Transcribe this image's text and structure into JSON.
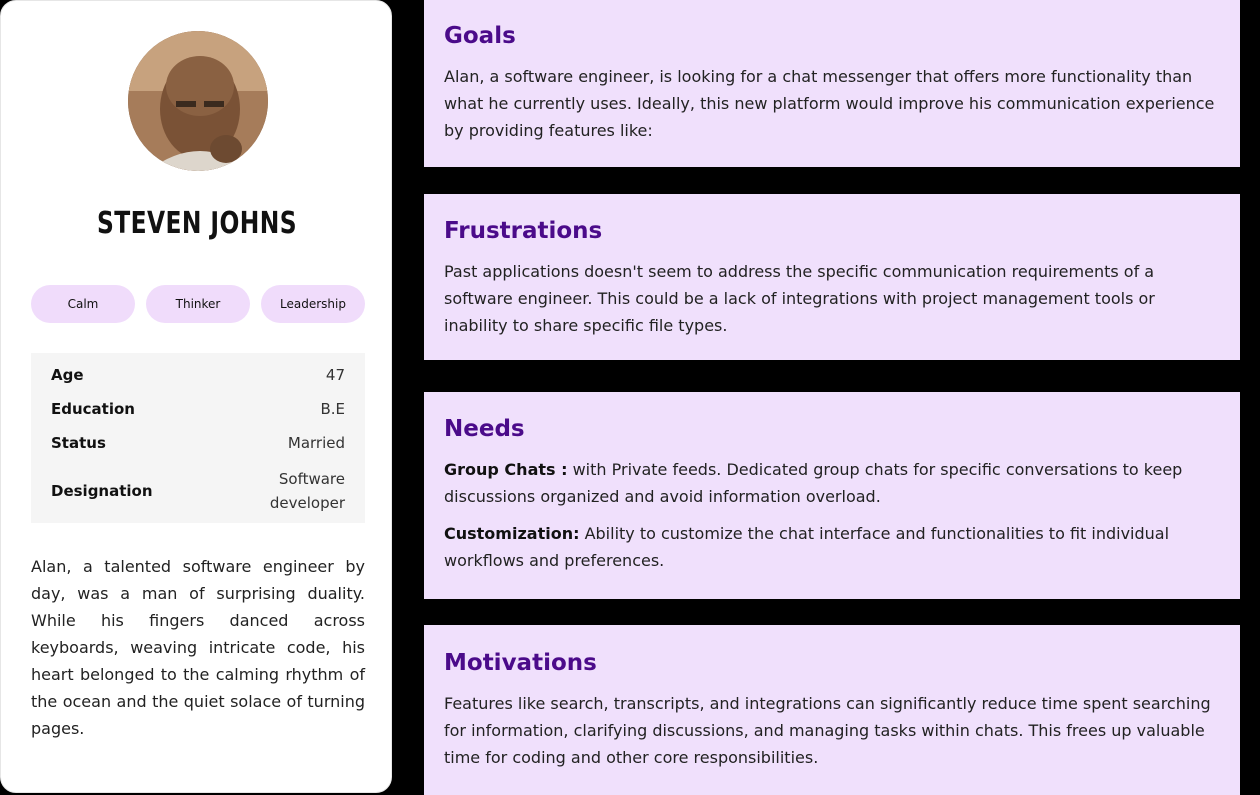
{
  "profile": {
    "name": "STEVEN JOHNS",
    "tags": [
      "Calm",
      "Thinker",
      "Leadership"
    ],
    "info": [
      {
        "key": "Age",
        "value": "47"
      },
      {
        "key": "Education",
        "value": "B.E"
      },
      {
        "key": "Status",
        "value": "Married"
      },
      {
        "key": "Designation",
        "value": "Software developer"
      }
    ],
    "bio": "Alan, a talented software engineer by day, was a man of surprising duality. While his fingers danced across keyboards, weaving intricate code, his heart belonged to the calming rhythm of the ocean and the quiet solace of turning pages."
  },
  "goals": {
    "title": "Goals",
    "text": "Alan, a software engineer, is looking for a chat messenger that offers more functionality than what he currently uses. Ideally, this new platform would improve his communication experience by providing features like:"
  },
  "frustrations": {
    "title": "Frustrations",
    "text": "Past applications doesn't seem to address the specific communication requirements of a software engineer. This could be a lack of integrations with project management tools or inability to share specific file types."
  },
  "needs": {
    "title": "Needs",
    "items": [
      {
        "label": "Group Chats :",
        "text": " with Private feeds. Dedicated group chats for specific conversations to keep discussions organized and avoid information overload."
      },
      {
        "label": "Customization:",
        "text": "  Ability to customize the chat interface and functionalities to fit individual workflows and preferences."
      }
    ]
  },
  "motivations": {
    "title": "Motivations",
    "text": "Features like search, transcripts, and integrations can significantly reduce time spent searching for information, clarifying discussions, and managing tasks within chats. This frees up valuable time for coding and other core responsibilities."
  }
}
